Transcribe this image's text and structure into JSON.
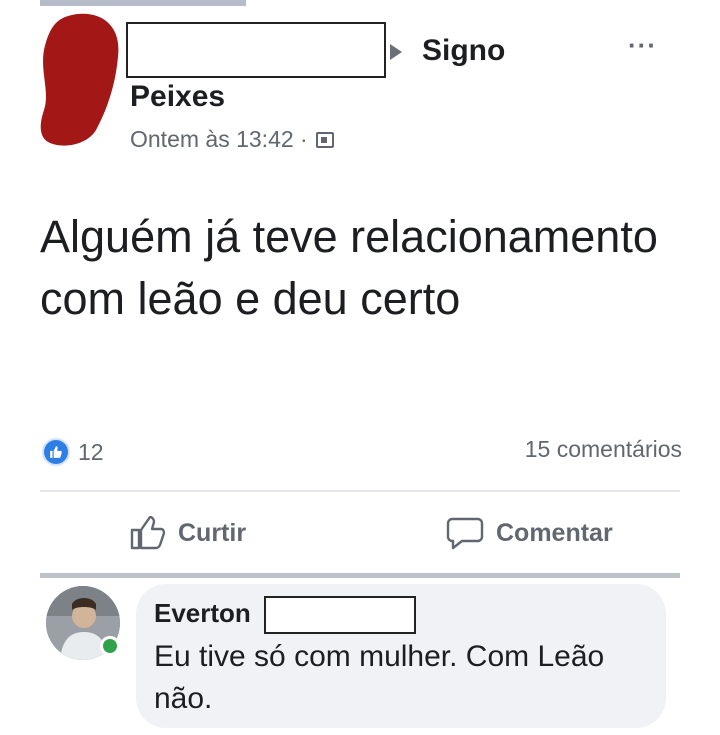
{
  "post": {
    "group_name_part1": "Signo",
    "group_name_part2": "Peixes",
    "time": "Ontem às 13:42 ·",
    "more_label": "···",
    "text": "Alguém já teve relacionamento com leão e deu certo",
    "reaction_count": "12",
    "comments_count": "15 comentários"
  },
  "actions": {
    "like_label": "Curtir",
    "comment_label": "Comentar"
  },
  "comment": {
    "author": "Everton",
    "text": "Eu tive só com mulher. Com Leão não."
  },
  "colors": {
    "avatar_blob": "#a31717",
    "like_blue": "#2d7fe6",
    "online_green": "#31a24c",
    "secondary_text": "#606770"
  },
  "icons": {
    "like": "thumbs-up-icon",
    "comment": "speech-bubble-icon",
    "public": "public-audience-icon",
    "more": "more-options-icon"
  }
}
